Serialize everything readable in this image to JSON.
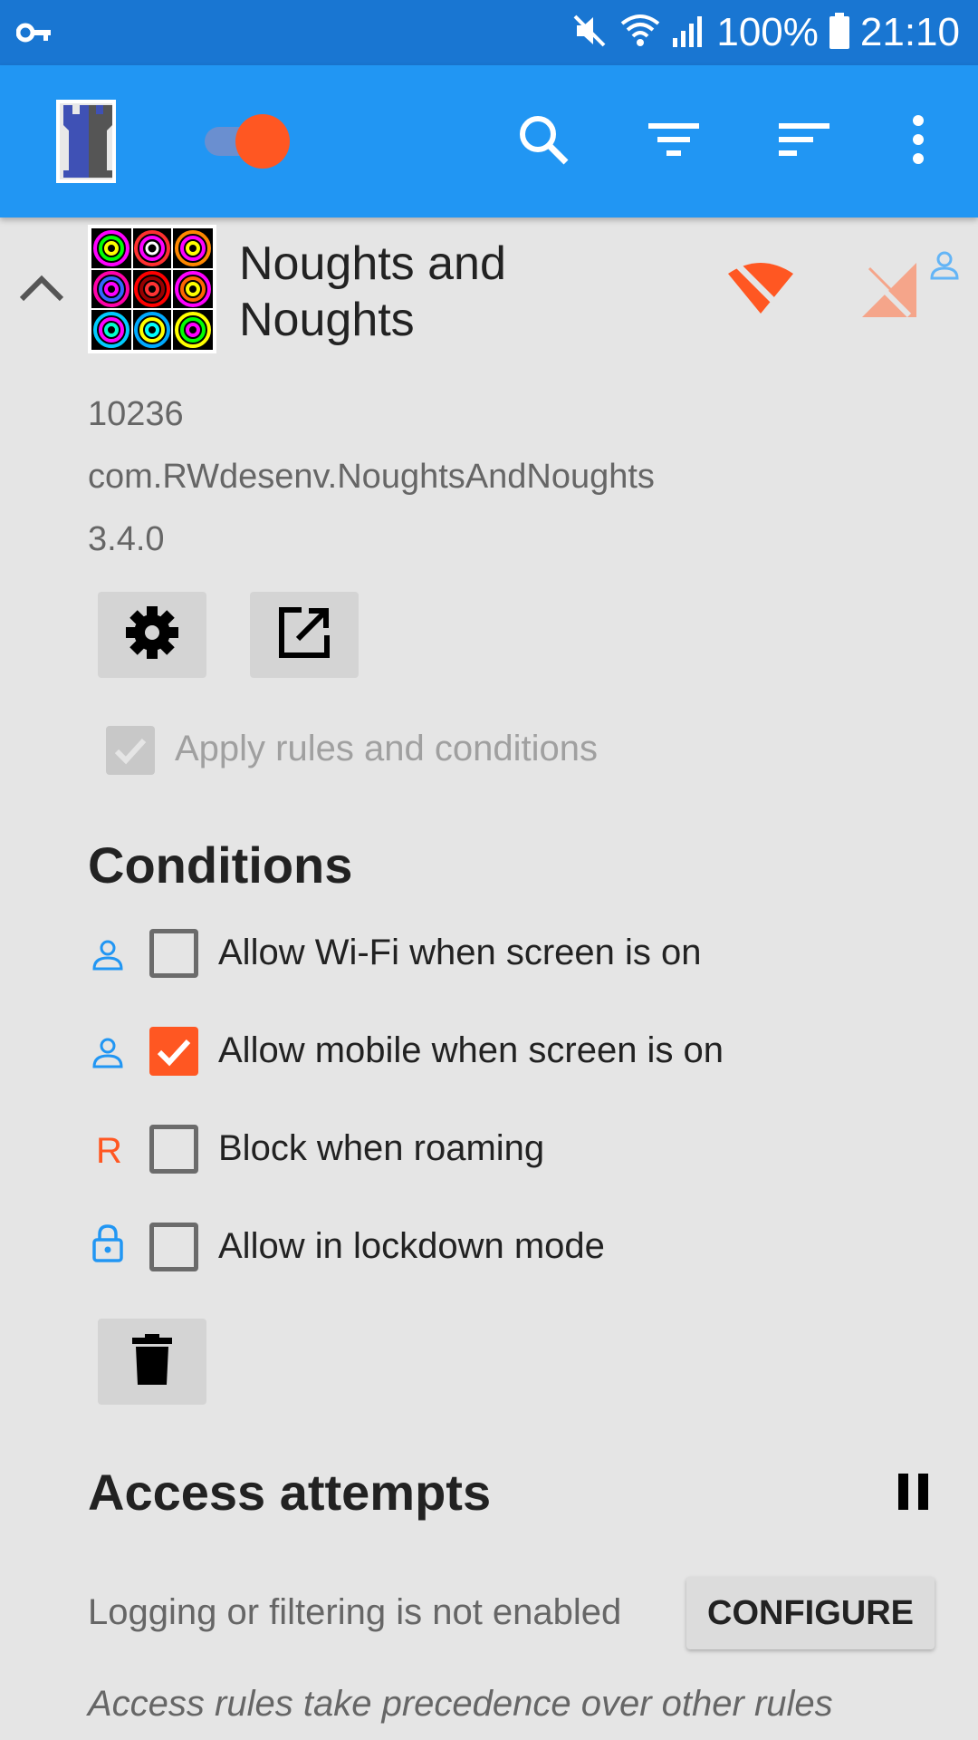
{
  "status_bar": {
    "battery": "100%",
    "time": "21:10",
    "icons": [
      "vpn-key-icon",
      "mute-icon",
      "wifi-icon",
      "signal-icon",
      "battery-icon"
    ]
  },
  "toolbar": {
    "icons": [
      "app-logo",
      "enabled-switch",
      "search-icon",
      "filter-icon",
      "sort-icon",
      "more-vert-icon"
    ]
  },
  "app": {
    "name": "Noughts and Noughts",
    "uid": "10236",
    "package": "com.RWdesenv.NoughtsAndNoughts",
    "version": "3.4.0",
    "apply_rules_label": "Apply rules and conditions"
  },
  "conditions": {
    "title": "Conditions",
    "items": [
      {
        "label": "Allow Wi-Fi when screen is on",
        "checked": false,
        "icon": "person-icon"
      },
      {
        "label": "Allow mobile when screen is on",
        "checked": true,
        "icon": "person-icon"
      },
      {
        "label": "Block when roaming",
        "checked": false,
        "icon": "R"
      },
      {
        "label": "Allow in lockdown mode",
        "checked": false,
        "icon": "lock-icon"
      }
    ]
  },
  "access": {
    "title": "Access attempts",
    "logging_text": "Logging or filtering is not enabled",
    "configure_label": "CONFIGURE",
    "note": "Access rules take precedence over other rules"
  },
  "colors": {
    "status_bar": "#1976d2",
    "toolbar": "#2196f3",
    "accent": "#ff5722",
    "person_icon": "#2196f3"
  }
}
